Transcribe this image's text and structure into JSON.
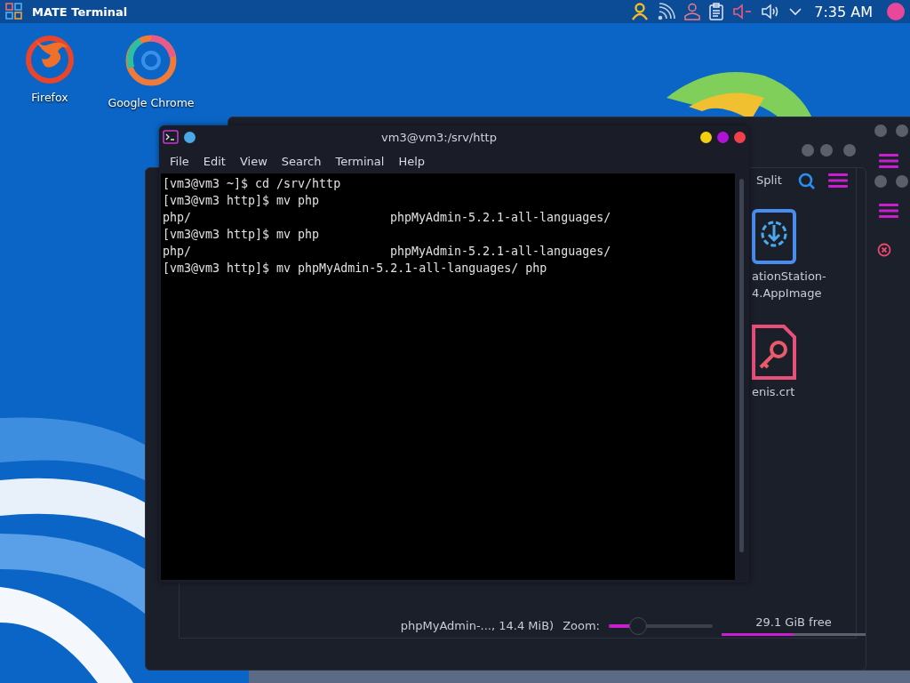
{
  "panel": {
    "title": "MATE Terminal",
    "clock": "7:35 AM"
  },
  "desktop_icons": [
    {
      "label": "Firefox",
      "kind": "flame"
    },
    {
      "label": "Google Chrome",
      "kind": "ring"
    }
  ],
  "file_manager": {
    "toolbar_label": "Split",
    "files": [
      {
        "kind": "appimage",
        "name_lines": [
          "ationStation-",
          "4.AppImage"
        ]
      },
      {
        "kind": "certificate",
        "name_lines": [
          "enis.crt"
        ]
      }
    ],
    "status": "phpMyAdmin-..., 14.4 MiB)",
    "zoom_label": "Zoom:",
    "zoom": {
      "level": 0.27
    },
    "free_space": "29.1 GiB free",
    "disk": {
      "level": 0.5
    }
  },
  "terminal": {
    "title": "vm3@vm3:/srv/http",
    "menu": [
      "File",
      "Edit",
      "View",
      "Search",
      "Terminal",
      "Help"
    ],
    "lines": [
      {
        "kind": "prompt",
        "text": "[vm3@vm3 ~]$ cd /srv/http"
      },
      {
        "kind": "prompt",
        "text": "[vm3@vm3 http]$ mv php"
      },
      {
        "kind": "listing",
        "columns": [
          "php/",
          "phpMyAdmin-5.2.1-all-languages/"
        ]
      },
      {
        "kind": "prompt",
        "text": "[vm3@vm3 http]$ mv php"
      },
      {
        "kind": "listing",
        "columns": [
          "php/",
          "phpMyAdmin-5.2.1-all-languages/"
        ]
      },
      {
        "kind": "prompt",
        "text": "[vm3@vm3 http]$ mv phpMyAdmin-5.2.1-all-languages/ php"
      }
    ]
  }
}
